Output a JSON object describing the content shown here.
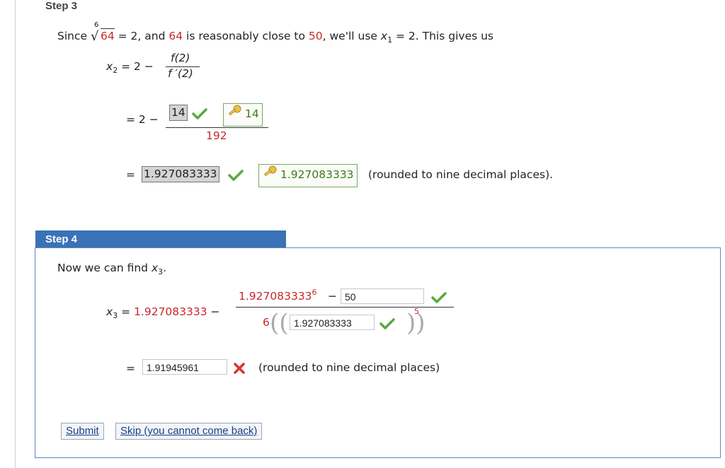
{
  "step3": {
    "label": "Step 3",
    "intro": {
      "since": "Since",
      "root_index": "6",
      "radicand": "64",
      "eq1": "= 2, and",
      "n64": "64",
      "mid": "is reasonably close to",
      "n50": "50",
      "tail": ", we'll use",
      "x1_var": "x",
      "x1_sub": "1",
      "x1_eq": "= 2. This gives us"
    },
    "line1": {
      "x_var": "x",
      "x_sub": "2",
      "lhs": "= 2 −",
      "numerator": "f(2)",
      "denominator": "f ′(2)"
    },
    "line2": {
      "lhs": "= 2 −",
      "answer": "14",
      "key_answer": "14",
      "denominator": "192"
    },
    "line3": {
      "eq": "=",
      "answer": "1.927083333",
      "key_answer": "1.927083333",
      "note": "(rounded to nine decimal places)."
    }
  },
  "step4": {
    "label": "Step 4",
    "intro_text": "Now we can find",
    "x3_var": "x",
    "x3_sub": "3",
    "x3_period": ".",
    "formula": {
      "x_var": "x",
      "x_sub": "3",
      "eq": "=",
      "value": "1.927083333",
      "minus": "−",
      "num_base": "1.927083333",
      "num_exp": "6",
      "num_minus": "−",
      "num_input": "50",
      "den_coef": "6",
      "den_input": "1.927083333",
      "den_exp": "5"
    },
    "result": {
      "eq": "=",
      "input": "1.91945961",
      "note": "(rounded to nine decimal places)"
    },
    "buttons": {
      "submit": "Submit",
      "skip": "Skip (you cannot come back)"
    }
  },
  "colors": {
    "red": "#c8282a",
    "green": "#3a7d1c",
    "step_tab": "#3a72b8",
    "step_border": "#5b86c4"
  }
}
